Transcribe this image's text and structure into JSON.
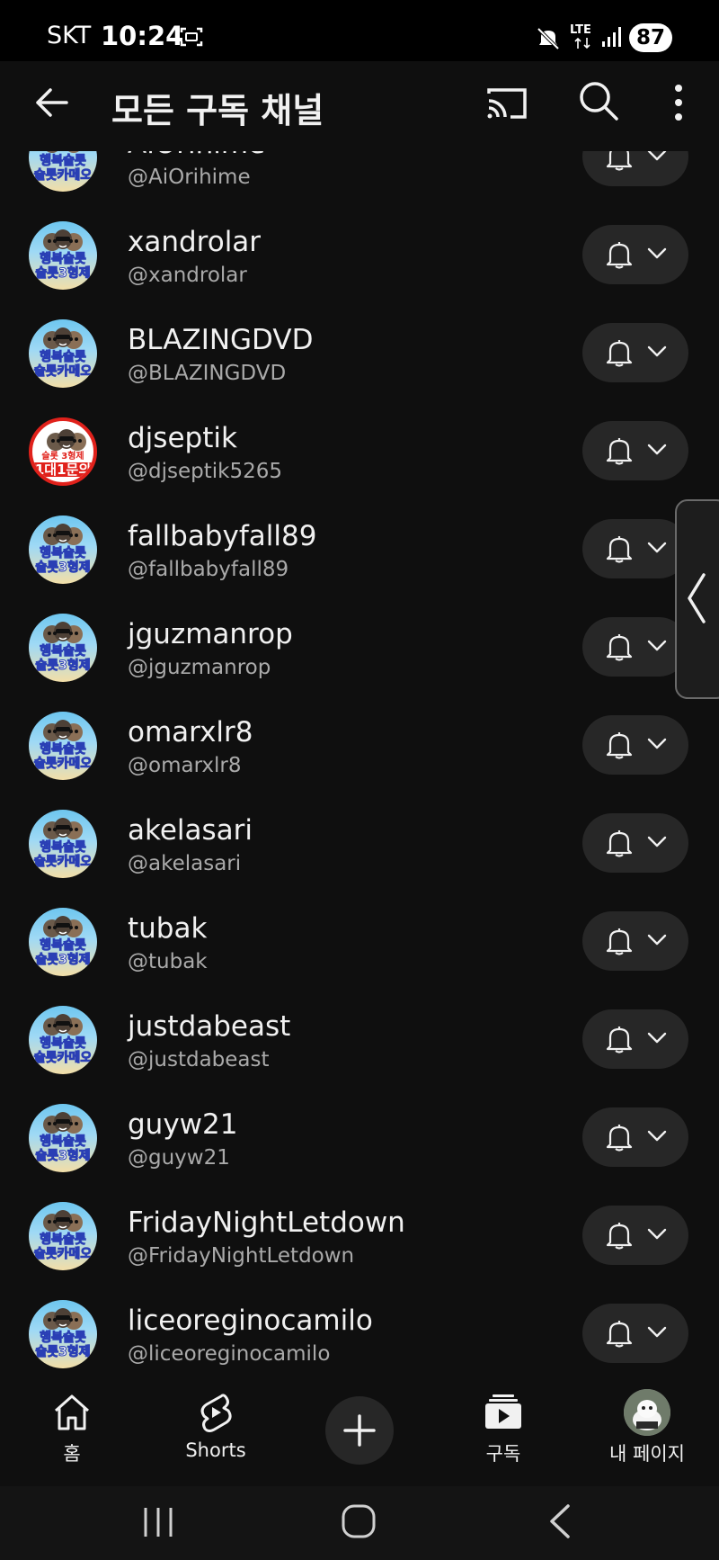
{
  "status_bar": {
    "carrier": "SKT",
    "time": "10:24",
    "network": "LTE",
    "battery": "87"
  },
  "header": {
    "title": "모든 구독 채널"
  },
  "channels": [
    {
      "name": "AiOrihime",
      "handle": "@AiOrihime",
      "avatar_top": "행복슬롯",
      "avatar_bottom": "슬롯카메오"
    },
    {
      "name": "xandrolar",
      "handle": "@xandrolar",
      "avatar_top": "행복슬롯",
      "avatar_bottom": "슬롯3형제"
    },
    {
      "name": "BLAZINGDVD",
      "handle": "@BLAZINGDVD",
      "avatar_top": "행복슬롯",
      "avatar_bottom": "슬롯카메오"
    },
    {
      "name": "djseptik",
      "handle": "@djseptik5265",
      "avatar_top": "슬롯 3형제",
      "avatar_bottom": "1대1문의"
    },
    {
      "name": "fallbabyfall89",
      "handle": "@fallbabyfall89",
      "avatar_top": "행복슬롯",
      "avatar_bottom": "슬롯3형제"
    },
    {
      "name": "jguzmanrop",
      "handle": "@jguzmanrop",
      "avatar_top": "행복슬롯",
      "avatar_bottom": "슬롯3형제"
    },
    {
      "name": "omarxlr8",
      "handle": "@omarxlr8",
      "avatar_top": "행복슬롯",
      "avatar_bottom": "슬롯카메오"
    },
    {
      "name": "akelasari",
      "handle": "@akelasari",
      "avatar_top": "행복슬롯",
      "avatar_bottom": "슬롯카메오"
    },
    {
      "name": "tubak",
      "handle": "@tubak",
      "avatar_top": "행복슬롯",
      "avatar_bottom": "슬롯3형제"
    },
    {
      "name": "justdabeast",
      "handle": "@justdabeast",
      "avatar_top": "행복슬롯",
      "avatar_bottom": "슬롯카메오"
    },
    {
      "name": "guyw21",
      "handle": "@guyw21",
      "avatar_top": "행복슬롯",
      "avatar_bottom": "슬롯3형제"
    },
    {
      "name": "FridayNightLetdown",
      "handle": "@FridayNightLetdown",
      "avatar_top": "행복슬롯",
      "avatar_bottom": "슬롯카메오"
    },
    {
      "name": "liceoreginocamilo",
      "handle": "@liceoreginocamilo",
      "avatar_top": "행복슬롯",
      "avatar_bottom": "슬롯3형제"
    }
  ],
  "bottom_nav": {
    "home": "홈",
    "shorts": "Shorts",
    "subscriptions": "구독",
    "you": "내 페이지"
  },
  "icons": {
    "back": "back-arrow-icon",
    "cast": "cast-icon",
    "search": "search-icon",
    "more": "more-vert-icon",
    "bell": "bell-icon",
    "chevron": "chevron-down-icon"
  }
}
